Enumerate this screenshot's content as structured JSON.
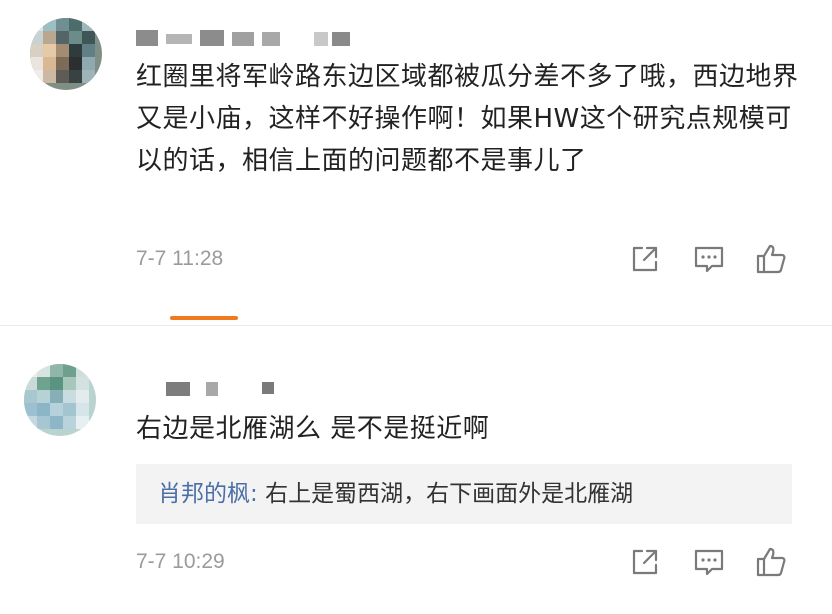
{
  "comments": [
    {
      "text": "红圈里将军岭路东边区域都被瓜分差不多了哦，西边地界又是小庙，这样不好操作啊！如果HW这个研究点规模可以的话，相信上面的问题都不是事儿了",
      "time": "7-7 11:28"
    },
    {
      "text": "右边是北雁湖么 是不是挺近啊",
      "time": "7-7 10:29",
      "reply": {
        "author": "肖邦的枫",
        "text": "右上是蜀西湖，右下画面外是北雁湖"
      }
    }
  ],
  "icons": {
    "share": "share-icon",
    "comment": "comment-icon",
    "like": "like-icon"
  },
  "colors": {
    "accent": "#f07a1f",
    "reply_author": "#4d6fa8",
    "meta": "#9b9b9b"
  }
}
